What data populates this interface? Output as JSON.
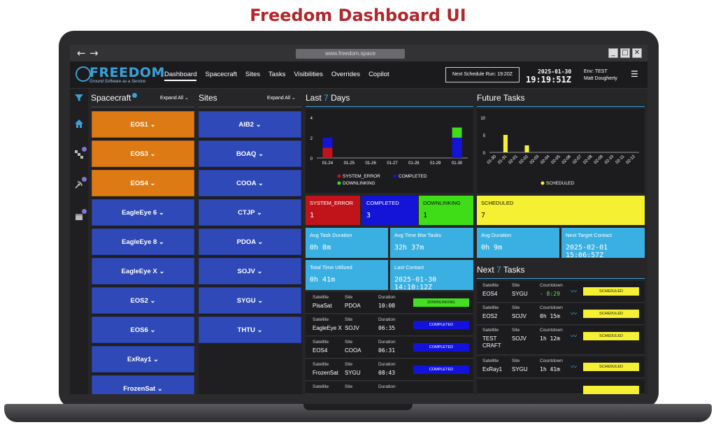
{
  "headline": "Freedom Dashboard UI",
  "browser": {
    "url": "www.freedom.space",
    "back": "←",
    "forward": "→",
    "win_min": "_",
    "win_max": "□",
    "win_close": "✕"
  },
  "app": {
    "logo_word": "FREEDOM",
    "logo_tag": "Ground Software as a Service",
    "nav": [
      "Dashboard",
      "Spacecraft",
      "Sites",
      "Tasks",
      "Visibilities",
      "Overrides",
      "Copilot"
    ],
    "next_schedule": "Next Schedule Run: 19:20Z",
    "date": "2025-01-30",
    "time": "19:19:51Z",
    "env": "Env: TEST",
    "user": "Matt Dougherty",
    "menu_icon": "☰"
  },
  "spacecraft": {
    "title": "Spacecraft",
    "expand": "Expand All",
    "items": [
      {
        "label": "EOS1 ⌄",
        "color": "orange"
      },
      {
        "label": "EOS3 ⌄",
        "color": "orange"
      },
      {
        "label": "EOS4 ⌄",
        "color": "orange"
      },
      {
        "label": "EagleEye 6 ⌄",
        "color": "blue"
      },
      {
        "label": "EagleEye 8 ⌄",
        "color": "blue"
      },
      {
        "label": "EagleEye X ⌄",
        "color": "blue"
      },
      {
        "label": "EOS2 ⌄",
        "color": "blue"
      },
      {
        "label": "EOS6 ⌄",
        "color": "blue"
      },
      {
        "label": "ExRay1 ⌄",
        "color": "blue"
      },
      {
        "label": "FrozenSat ⌄",
        "color": "blue"
      }
    ]
  },
  "sites": {
    "title": "Sites",
    "expand": "Expand All",
    "items": [
      "AIB2 ⌄",
      "BOAQ ⌄",
      "COOA ⌄",
      "CTJP ⌄",
      "PDOA ⌄",
      "SOJV ⌄",
      "SYGU ⌄",
      "THTU ⌄"
    ]
  },
  "last7": {
    "title_a": "Last",
    "title_hl": "7",
    "title_b": "Days",
    "legend": [
      "SYSTEM_ERROR",
      "COMPLETED",
      "DOWNLINKING"
    ],
    "cards": [
      {
        "label": "SYSTEM_ERROR",
        "value": "1",
        "color": "#c0141a"
      },
      {
        "label": "COMPLETED",
        "value": "3",
        "color": "#1414d8"
      },
      {
        "label": "DOWNLINKING",
        "value": "1",
        "color": "#3fdc18"
      }
    ],
    "stats": [
      {
        "label": "Avg Task Duration",
        "value": "0h 8m"
      },
      {
        "label": "Avg Time Btw Tasks",
        "value": "32h 37m"
      },
      {
        "label": "Total Time Utilized",
        "value": "0h 41m"
      },
      {
        "label": "Last Contact",
        "value": "2025-01-30 14:10:12Z"
      }
    ],
    "tasks": [
      {
        "satellite": "PisaSat",
        "site": "PDOA",
        "duration": "10:08",
        "status": "DOWNLINKING"
      },
      {
        "satellite": "EagleEye X",
        "site": "SOJV",
        "duration": "06:35",
        "status": "COMPLETED"
      },
      {
        "satellite": "EOS4",
        "site": "COOA",
        "duration": "06:31",
        "status": "COMPLETED"
      },
      {
        "satellite": "FrozenSat",
        "site": "SYGU",
        "duration": "08:43",
        "status": "COMPLETED"
      }
    ],
    "captions": {
      "satellite": "Satellite",
      "site": "Site",
      "duration": "Duration"
    }
  },
  "future": {
    "title": "Future Tasks",
    "legend": "SCHEDULED",
    "card": {
      "label": "SCHEDULED",
      "value": "7"
    },
    "stats": [
      {
        "label": "Avg Duration",
        "value": "0h 9m"
      },
      {
        "label": "Next Target Contact",
        "value": "2025-02-01 15:06:57Z"
      }
    ],
    "next_title_a": "Next",
    "next_title_hl": "7",
    "next_title_b": "Tasks",
    "captions": {
      "satellite": "Satellite",
      "site": "Site",
      "countdown": "Countdown"
    },
    "tasks": [
      {
        "satellite": "EOS4",
        "site": "SYGU",
        "countdown": "- 8:29",
        "status": "SCHEDULED"
      },
      {
        "satellite": "EOS2",
        "site": "SOJV",
        "countdown": "0h 15m",
        "status": "SCHEDULED"
      },
      {
        "satellite": "TEST CRAFT",
        "site": "SOJV",
        "countdown": "1h 12m",
        "status": "SCHEDULED"
      },
      {
        "satellite": "ExRay1",
        "site": "SYGU",
        "countdown": "1h 41m",
        "status": "SCHEDULED"
      }
    ]
  },
  "chart_data": [
    {
      "type": "bar",
      "categories": [
        "01-24",
        "01-25",
        "01-26",
        "01-27",
        "01-28",
        "01-29",
        "01-30"
      ],
      "series": [
        {
          "name": "SYSTEM_ERROR",
          "color": "#c0141a",
          "values": [
            1,
            0,
            0,
            0,
            0,
            0,
            0
          ]
        },
        {
          "name": "COMPLETED",
          "color": "#1414d8",
          "values": [
            1,
            0,
            0,
            0,
            0,
            0,
            2
          ]
        },
        {
          "name": "DOWNLINKING",
          "color": "#3fdc18",
          "values": [
            0,
            0,
            0,
            0,
            0,
            0,
            1
          ]
        }
      ],
      "stacked": true,
      "yticks": [
        0,
        2,
        4
      ],
      "ylim": [
        0,
        4
      ]
    },
    {
      "type": "bar",
      "categories": [
        "01-30",
        "01-31",
        "02-01",
        "02-02",
        "02-03",
        "02-04",
        "02-05",
        "02-06",
        "02-07",
        "02-08",
        "02-09",
        "02-10",
        "02-11",
        "02-12"
      ],
      "series": [
        {
          "name": "SCHEDULED",
          "color": "#f5f032",
          "values": [
            0,
            5,
            0,
            2,
            0,
            0,
            0,
            0,
            0,
            0,
            0,
            0,
            0,
            0
          ]
        }
      ],
      "yticks": [
        0,
        5,
        10
      ],
      "ylim": [
        0,
        10
      ]
    }
  ]
}
